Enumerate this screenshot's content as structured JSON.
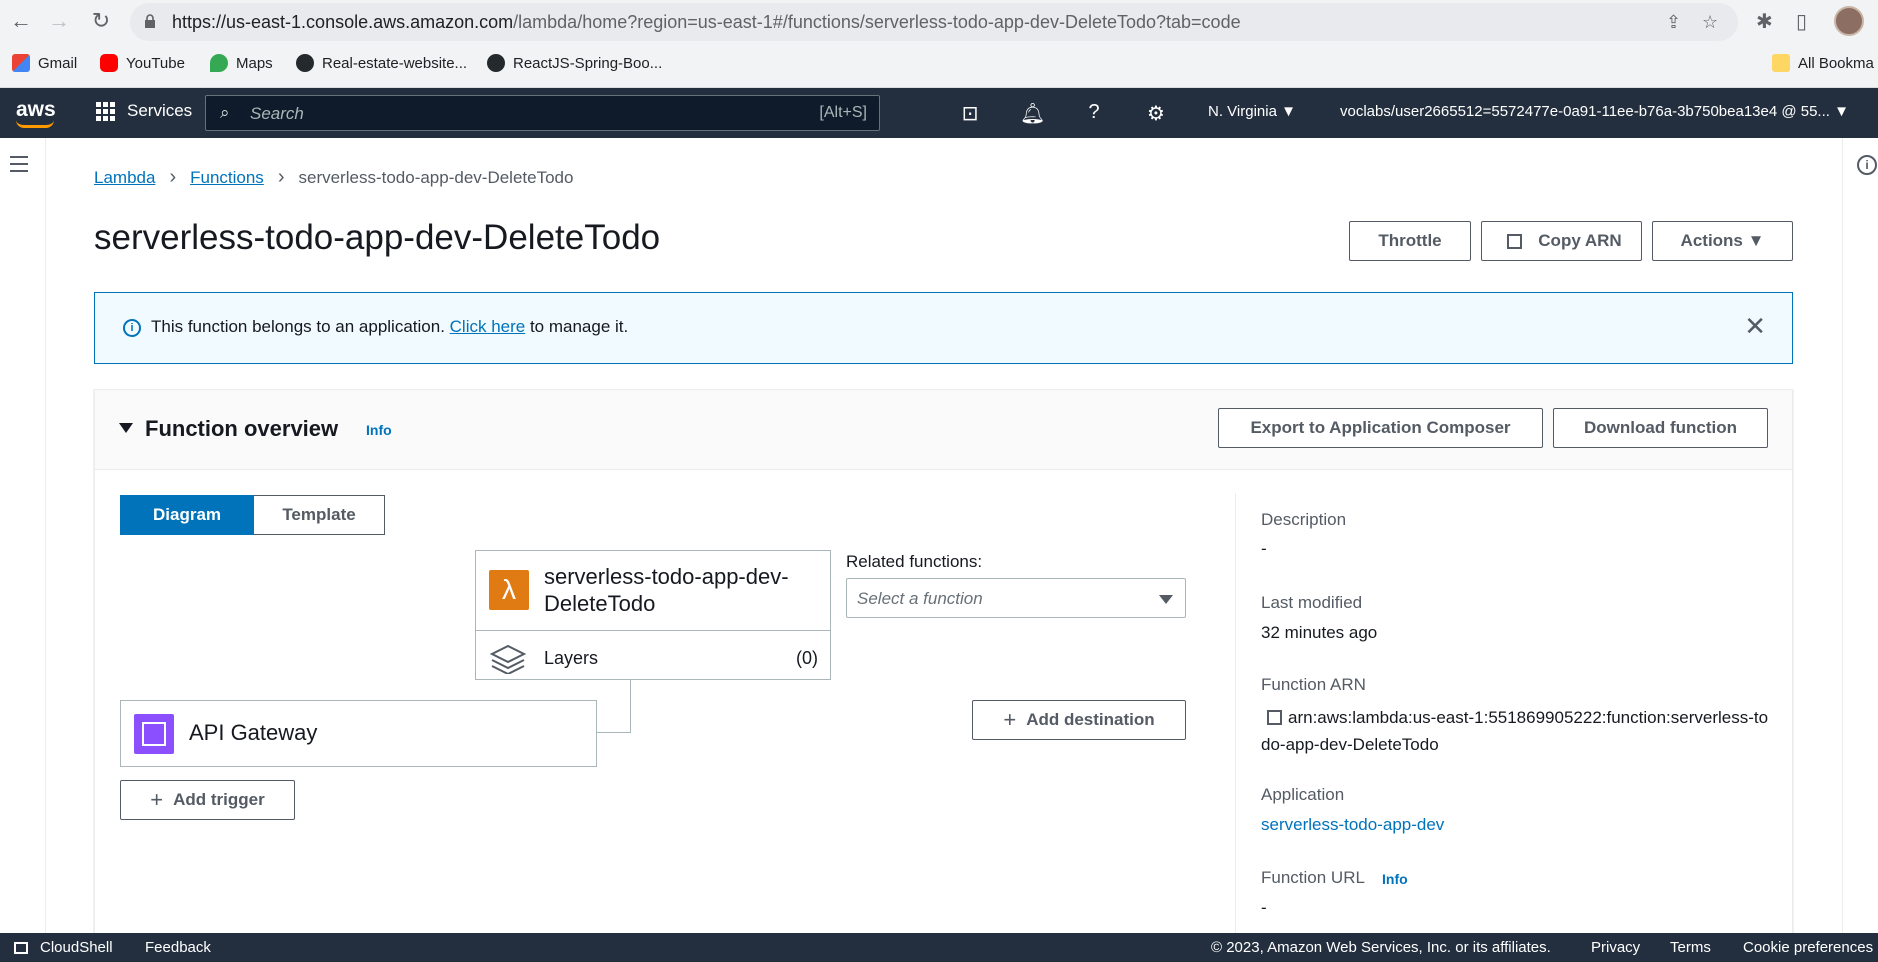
{
  "browser": {
    "url_host": "https://us-east-1.console.aws.amazon.com",
    "url_path": "/lambda/home?region=us-east-1#/functions/serverless-todo-app-dev-DeleteTodo?tab=code",
    "bookmarks": [
      "Gmail",
      "YouTube",
      "Maps",
      "Real-estate-website...",
      "ReactJS-Spring-Boo...",
      "All Bookma"
    ]
  },
  "aws_nav": {
    "logo": "aws",
    "services": "Services",
    "search_placeholder": "Search",
    "search_shortcut": "[Alt+S]",
    "region": "N. Virginia ▼",
    "account": "voclabs/user2665512=5572477e-0a91-11ee-b76a-3b750bea13e4 @ 55... ▼"
  },
  "breadcrumb": {
    "items": [
      "Lambda",
      "Functions"
    ],
    "current": "serverless-todo-app-dev-DeleteTodo"
  },
  "page": {
    "title": "serverless-todo-app-dev-DeleteTodo",
    "throttle": "Throttle",
    "copy_arn": "Copy ARN",
    "actions": "Actions ▼"
  },
  "flash": {
    "before": "This function belongs to an application. ",
    "link": "Click here",
    "after": " to manage it."
  },
  "overview": {
    "title": "Function overview",
    "info": "Info",
    "export": "Export to Application Composer",
    "download": "Download function",
    "tabs": [
      "Diagram",
      "Template"
    ],
    "function_name": "serverless-todo-app-dev-DeleteTodo",
    "layers_label": "Layers",
    "layers_count": "(0)",
    "related_label": "Related functions:",
    "related_placeholder": "Select a function",
    "trigger": "API Gateway",
    "add_trigger": "Add trigger",
    "add_destination": "Add destination"
  },
  "details": {
    "description_label": "Description",
    "description_value": "-",
    "modified_label": "Last modified",
    "modified_value": "32 minutes ago",
    "arn_label": "Function ARN",
    "arn_value": "arn:aws:lambda:us-east-1:551869905222:function:serverless-todo-app-dev-DeleteTodo",
    "application_label": "Application",
    "application_value": "serverless-todo-app-dev",
    "url_label": "Function URL",
    "url_info": "Info",
    "url_value": "-"
  },
  "footer": {
    "cloudshell": "CloudShell",
    "feedback": "Feedback",
    "copyright": "© 2023, Amazon Web Services, Inc. or its affiliates.",
    "privacy": "Privacy",
    "terms": "Terms",
    "cookies": "Cookie preferences"
  },
  "colors": {
    "aws_nav": "#232f3e",
    "accent": "#0073bb",
    "lambda": "#e07b13",
    "api_gateway": "#8c4fff"
  }
}
